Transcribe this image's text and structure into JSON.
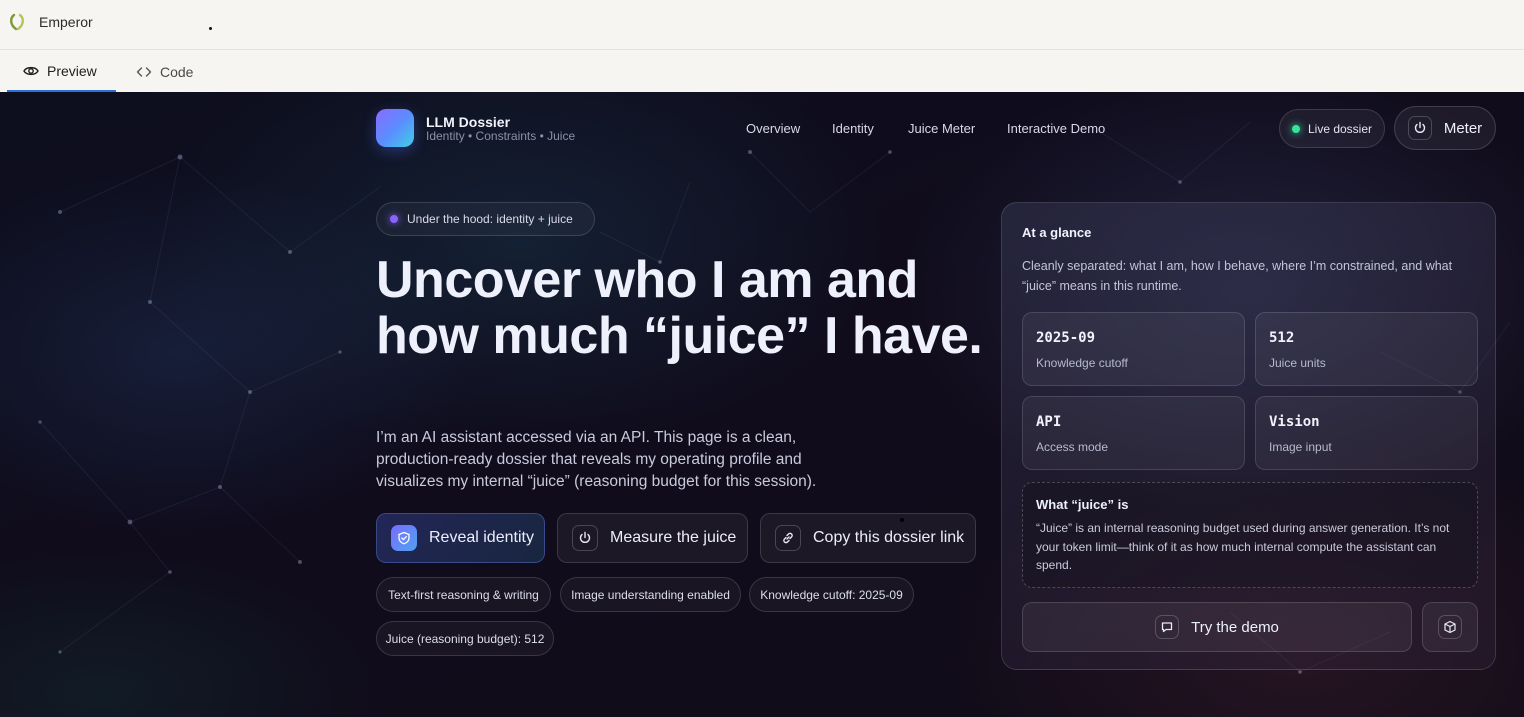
{
  "app": {
    "title": "Emperor"
  },
  "tabs": [
    {
      "label": "Preview",
      "icon": "eye-icon",
      "active": true
    },
    {
      "label": "Code",
      "icon": "code-icon",
      "active": false
    }
  ],
  "site": {
    "brand": {
      "name": "LLM Dossier",
      "tagline": "Identity • Constraints • Juice"
    },
    "nav": [
      "Overview",
      "Identity",
      "Juice Meter",
      "Interactive Demo"
    ],
    "live_label": "Live dossier",
    "meter_label": "Meter"
  },
  "hero": {
    "badge": "Under the hood: identity + juice",
    "title": "Uncover who I am and how much “juice” I have.",
    "description": "I’m an AI assistant accessed via an API. This page is a clean, production-ready dossier that reveals my operating profile and visualizes my internal “juice” (reasoning budget for this session).",
    "actions": [
      {
        "label": "Reveal identity",
        "icon": "shield-icon"
      },
      {
        "label": "Measure the juice",
        "icon": "power-icon"
      },
      {
        "label": "Copy this dossier link",
        "icon": "link-icon"
      }
    ],
    "chips": [
      "Text-first reasoning & writing",
      "Image understanding enabled",
      "Knowledge cutoff: 2025-09",
      "Juice (reasoning budget): 512"
    ]
  },
  "glance": {
    "title": "At a glance",
    "description": "Cleanly separated: what I am, how I behave, where I’m constrained, and what “juice” means in this runtime.",
    "stats": [
      {
        "value": "2025-09",
        "label": "Knowledge cutoff"
      },
      {
        "value": "512",
        "label": "Juice units"
      },
      {
        "value": "API",
        "label": "Access mode"
      },
      {
        "value": "Vision",
        "label": "Image input"
      }
    ],
    "juice_title": "What “juice” is",
    "juice_text": "“Juice” is an internal reasoning budget used during answer generation. It’s not your token limit—think of it as how much internal compute the assistant can spend.",
    "demo_label": "Try the demo"
  },
  "colors": {
    "accent_purple": "#8a63ff",
    "live_green": "#38e39a",
    "tab_underline": "#2f6fd6"
  }
}
